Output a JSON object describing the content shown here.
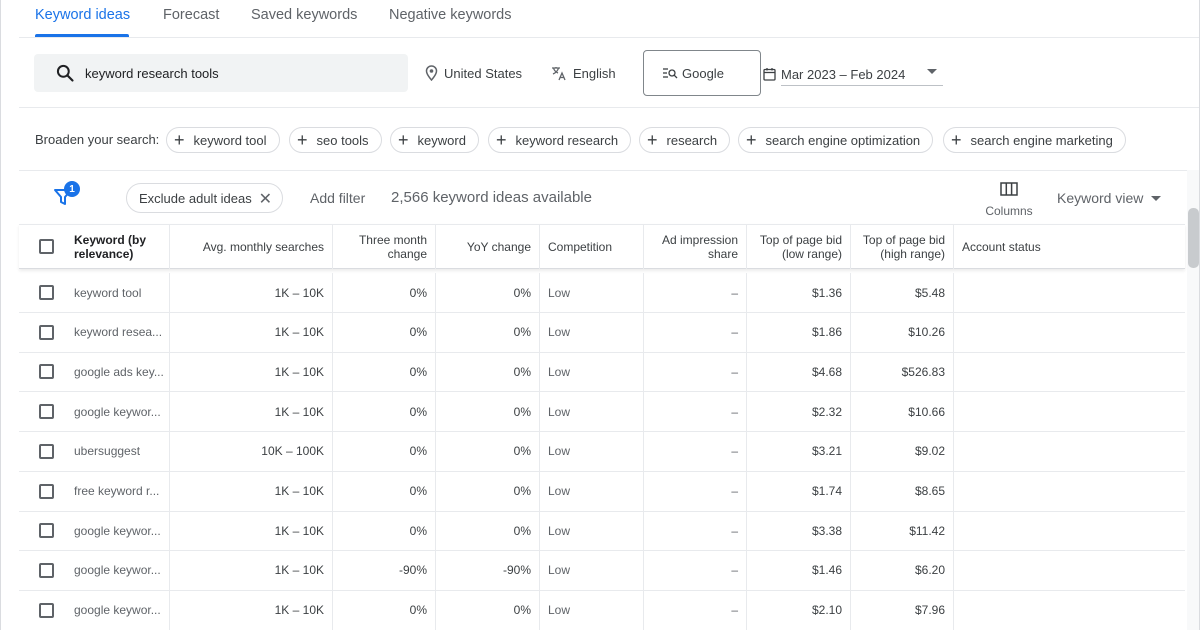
{
  "tabs": [
    {
      "label": "Keyword ideas",
      "active": true
    },
    {
      "label": "Forecast",
      "active": false
    },
    {
      "label": "Saved keywords",
      "active": false
    },
    {
      "label": "Negative keywords",
      "active": false
    }
  ],
  "search": {
    "value": "keyword research tools"
  },
  "location": {
    "label": "United States"
  },
  "language": {
    "label": "English"
  },
  "network": {
    "label": "Google"
  },
  "date_range": {
    "label": "Mar 2023 – Feb 2024"
  },
  "broaden": {
    "label": "Broaden your search:",
    "chips": [
      "keyword tool",
      "seo tools",
      "keyword",
      "keyword research",
      "research",
      "search engine optimization",
      "search engine marketing"
    ]
  },
  "filter_bar": {
    "filter_badge": "1",
    "exclude_chip": "Exclude adult ideas",
    "add_filter": "Add filter",
    "ideas_count": "2,566 keyword ideas available",
    "columns_label": "Columns",
    "view_label": "Keyword view"
  },
  "table": {
    "headers": {
      "keyword": "Keyword (by relevance)",
      "avg_searches": "Avg. monthly searches",
      "three_month": "Three month change",
      "yoy": "YoY change",
      "competition": "Competition",
      "ad_impr": "Ad impression share",
      "bid_low": "Top of page bid (low range)",
      "bid_high": "Top of page bid (high range)",
      "account_status": "Account status"
    },
    "rows": [
      {
        "keyword": "keyword tool",
        "avg": "1K – 10K",
        "three": "0%",
        "yoy": "0%",
        "comp": "Low",
        "impr": "–",
        "low": "$1.36",
        "high": "$5.48",
        "status": ""
      },
      {
        "keyword": "keyword resea...",
        "avg": "1K – 10K",
        "three": "0%",
        "yoy": "0%",
        "comp": "Low",
        "impr": "–",
        "low": "$1.86",
        "high": "$10.26",
        "status": ""
      },
      {
        "keyword": "google ads key...",
        "avg": "1K – 10K",
        "three": "0%",
        "yoy": "0%",
        "comp": "Low",
        "impr": "–",
        "low": "$4.68",
        "high": "$526.83",
        "status": ""
      },
      {
        "keyword": "google keywor...",
        "avg": "1K – 10K",
        "three": "0%",
        "yoy": "0%",
        "comp": "Low",
        "impr": "–",
        "low": "$2.32",
        "high": "$10.66",
        "status": ""
      },
      {
        "keyword": "ubersuggest",
        "avg": "10K – 100K",
        "three": "0%",
        "yoy": "0%",
        "comp": "Low",
        "impr": "–",
        "low": "$3.21",
        "high": "$9.02",
        "status": ""
      },
      {
        "keyword": "free keyword r...",
        "avg": "1K – 10K",
        "three": "0%",
        "yoy": "0%",
        "comp": "Low",
        "impr": "–",
        "low": "$1.74",
        "high": "$8.65",
        "status": ""
      },
      {
        "keyword": "google keywor...",
        "avg": "1K – 10K",
        "three": "0%",
        "yoy": "0%",
        "comp": "Low",
        "impr": "–",
        "low": "$3.38",
        "high": "$11.42",
        "status": ""
      },
      {
        "keyword": "google keywor...",
        "avg": "1K – 10K",
        "three": "-90%",
        "yoy": "-90%",
        "comp": "Low",
        "impr": "–",
        "low": "$1.46",
        "high": "$6.20",
        "status": ""
      },
      {
        "keyword": "google keywor...",
        "avg": "1K – 10K",
        "three": "0%",
        "yoy": "0%",
        "comp": "Low",
        "impr": "–",
        "low": "$2.10",
        "high": "$7.96",
        "status": ""
      }
    ]
  },
  "colors": {
    "accent": "#1a73e8",
    "text": "#3c4043",
    "muted": "#5f6368",
    "border": "#e8eaed"
  },
  "icons": {
    "search": "search-icon",
    "location": "location-pin-icon",
    "language": "translate-icon",
    "network": "search-network-icon",
    "calendar": "calendar-icon",
    "filter": "filter-icon",
    "columns": "columns-icon"
  }
}
